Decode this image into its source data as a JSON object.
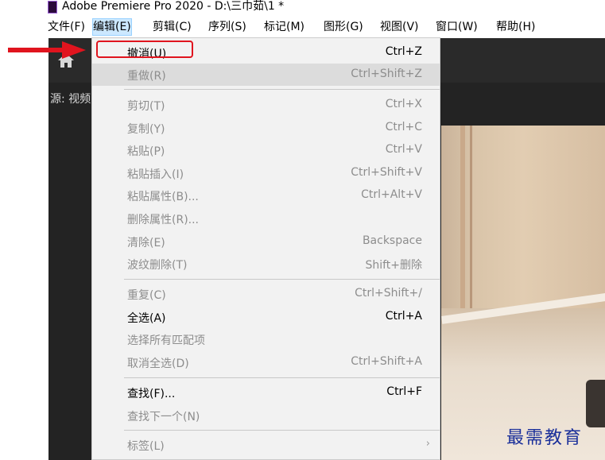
{
  "window": {
    "title": "Adobe Premiere Pro 2020 - D:\\三巾茹\\1 *"
  },
  "menubar": {
    "items": [
      {
        "label": "文件(F)"
      },
      {
        "label": "编辑(E)"
      },
      {
        "label": "剪辑(C)"
      },
      {
        "label": "序列(S)"
      },
      {
        "label": "标记(M)"
      },
      {
        "label": "图形(G)"
      },
      {
        "label": "视图(V)"
      },
      {
        "label": "窗口(W)"
      },
      {
        "label": "帮助(H)"
      }
    ],
    "active_index": 1
  },
  "panel": {
    "source_label": "源: 视频"
  },
  "edit_menu": {
    "items": [
      {
        "label": "撤消(U)",
        "shortcut": "Ctrl+Z",
        "enabled": true
      },
      {
        "label": "重做(R)",
        "shortcut": "Ctrl+Shift+Z",
        "enabled": false
      },
      {
        "label": "剪切(T)",
        "shortcut": "Ctrl+X",
        "enabled": false
      },
      {
        "label": "复制(Y)",
        "shortcut": "Ctrl+C",
        "enabled": false
      },
      {
        "label": "粘贴(P)",
        "shortcut": "Ctrl+V",
        "enabled": false
      },
      {
        "label": "粘贴插入(I)",
        "shortcut": "Ctrl+Shift+V",
        "enabled": false
      },
      {
        "label": "粘贴属性(B)...",
        "shortcut": "Ctrl+Alt+V",
        "enabled": false
      },
      {
        "label": "删除属性(R)...",
        "shortcut": "",
        "enabled": false
      },
      {
        "label": "清除(E)",
        "shortcut": "Backspace",
        "enabled": false
      },
      {
        "label": "波纹删除(T)",
        "shortcut": "Shift+删除",
        "enabled": false
      },
      {
        "label": "重复(C)",
        "shortcut": "Ctrl+Shift+/",
        "enabled": false
      },
      {
        "label": "全选(A)",
        "shortcut": "Ctrl+A",
        "enabled": true
      },
      {
        "label": "选择所有匹配项",
        "shortcut": "",
        "enabled": false
      },
      {
        "label": "取消全选(D)",
        "shortcut": "Ctrl+Shift+A",
        "enabled": false
      },
      {
        "label": "查找(F)...",
        "shortcut": "Ctrl+F",
        "enabled": true
      },
      {
        "label": "查找下一个(N)",
        "shortcut": "",
        "enabled": false
      },
      {
        "label": "标签(L)",
        "shortcut": "",
        "enabled": false,
        "submenu_icon": "chevron-right-icon"
      }
    ],
    "hovered_index": 1
  },
  "annotations": {
    "arrow_color": "#e0141e",
    "box_color": "#e0141e"
  },
  "watermark": {
    "text": "最需教育",
    "color": "#1a2f9a"
  }
}
